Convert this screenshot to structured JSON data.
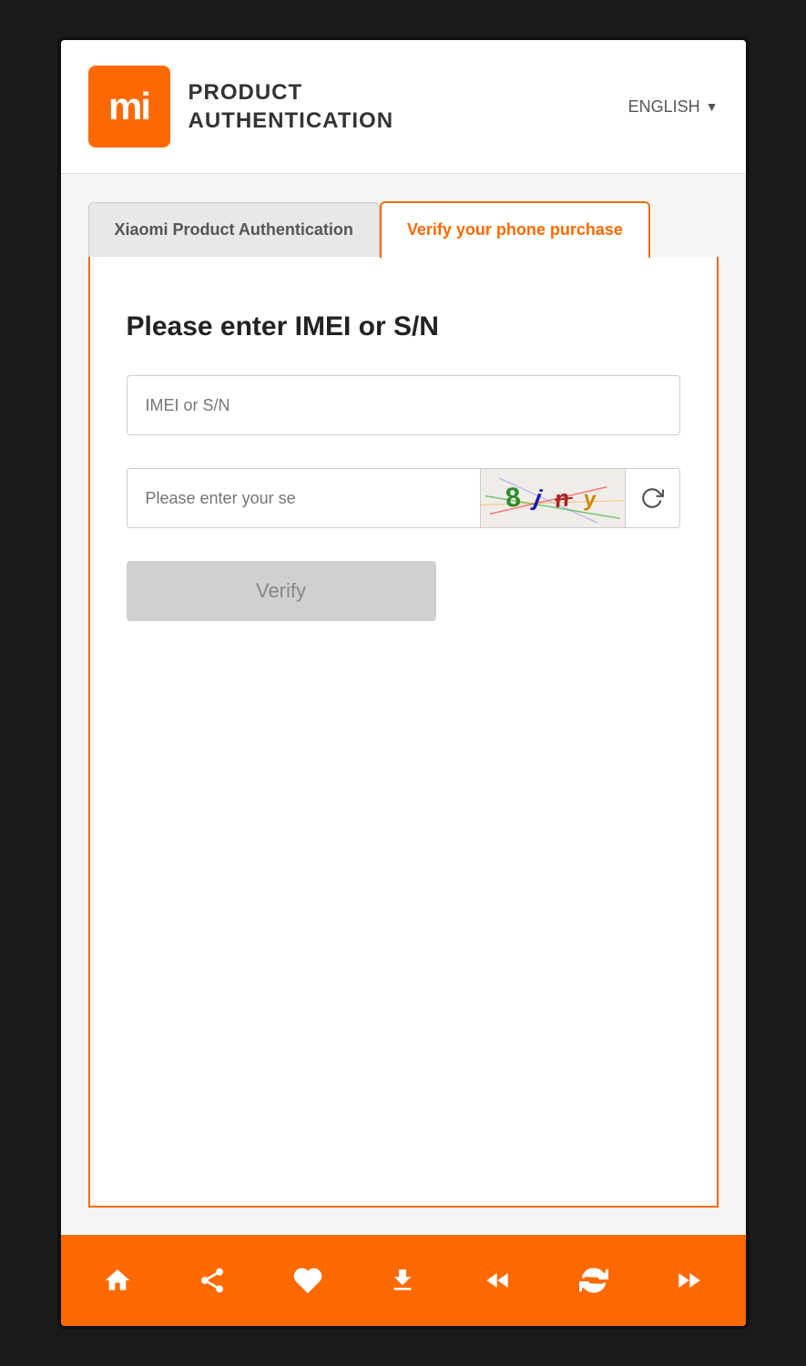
{
  "header": {
    "logo_text": "mi",
    "brand_line1": "PRODUCT",
    "brand_line2": "AUTHENTICATION",
    "language_label": "ENGLISH",
    "chevron": "▼"
  },
  "tabs": [
    {
      "id": "tab-product-auth",
      "label": "Xiaomi Product Authentication",
      "active": false
    },
    {
      "id": "tab-verify-phone",
      "label": "Verify your phone purchase",
      "active": true
    }
  ],
  "form": {
    "title": "Please enter IMEI or S/N",
    "imei_placeholder": "IMEI or S/N",
    "captcha_placeholder": "Please enter your se",
    "captcha_chars": "8 j n y",
    "verify_label": "Verify",
    "refresh_icon": "↻"
  },
  "bottom_nav": {
    "items": [
      "home",
      "share",
      "heart",
      "download",
      "rewind",
      "refresh",
      "fast-forward"
    ]
  }
}
